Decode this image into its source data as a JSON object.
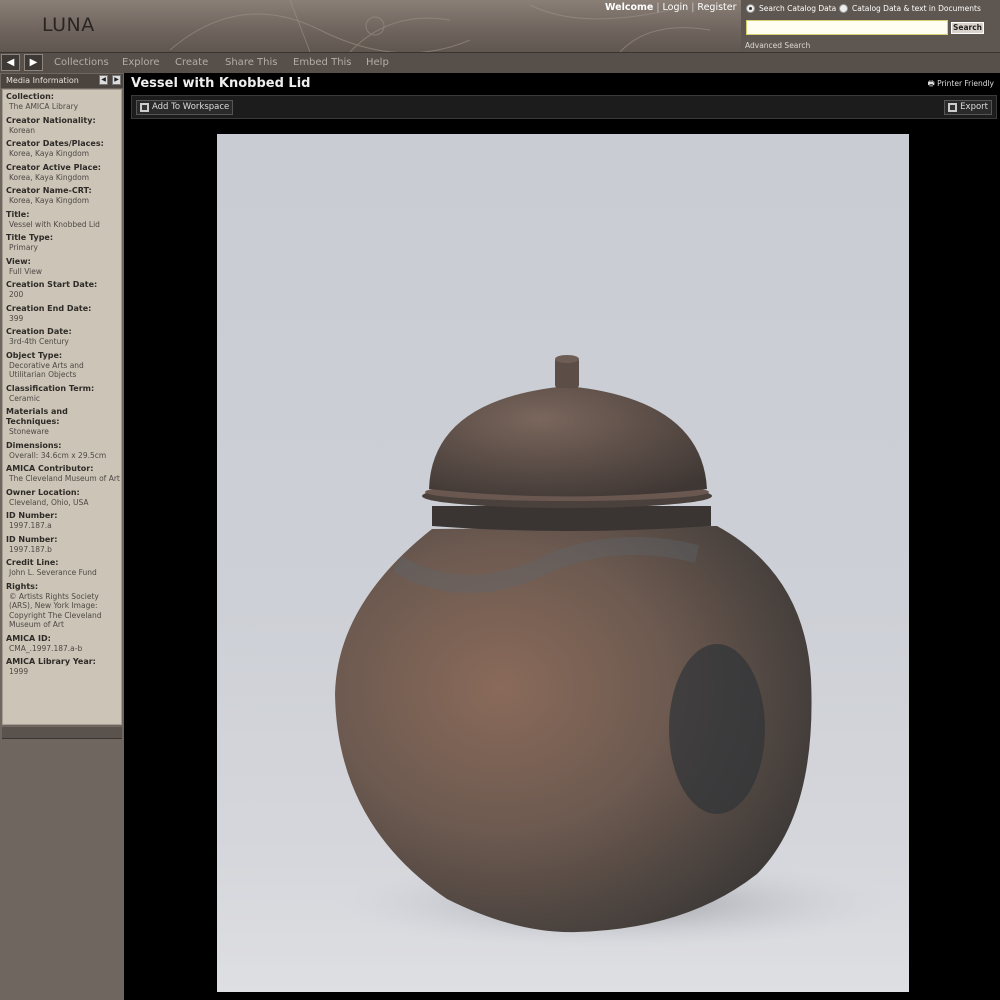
{
  "header": {
    "logo": "LUNA",
    "welcome": "Welcome",
    "login": "Login",
    "register": "Register",
    "search_option_catalog": "Search Catalog Data",
    "search_option_documents": "Catalog Data & text in Documents",
    "search_button": "Search",
    "advanced_search": "Advanced Search"
  },
  "nav": {
    "back_arrow": "◀",
    "forward_arrow": "▶",
    "items": [
      "Collections",
      "Explore",
      "Create",
      "Share This",
      "Embed This",
      "Help"
    ]
  },
  "panel": {
    "title": "Media Information",
    "collapse": "◀",
    "expand": "▶"
  },
  "metadata": [
    {
      "label": "Collection:",
      "value": "The AMICA Library"
    },
    {
      "label": "Creator Nationality:",
      "value": "Korean"
    },
    {
      "label": "Creator Dates/Places:",
      "value": "Korea, Kaya Kingdom"
    },
    {
      "label": "Creator Active Place:",
      "value": "Korea, Kaya Kingdom"
    },
    {
      "label": "Creator Name-CRT:",
      "value": "Korea, Kaya Kingdom"
    },
    {
      "label": "Title:",
      "value": "Vessel with Knobbed Lid"
    },
    {
      "label": "Title Type:",
      "value": "Primary"
    },
    {
      "label": "View:",
      "value": "Full View"
    },
    {
      "label": "Creation Start Date:",
      "value": "200"
    },
    {
      "label": "Creation End Date:",
      "value": "399"
    },
    {
      "label": "Creation Date:",
      "value": "3rd-4th Century"
    },
    {
      "label": "Object Type:",
      "value": "Decorative Arts and Utilitarian Objects"
    },
    {
      "label": "Classification Term:",
      "value": "Ceramic"
    },
    {
      "label": "Materials and Techniques:",
      "value": "Stoneware"
    },
    {
      "label": "Dimensions:",
      "value": "Overall: 34.6cm x 29.5cm"
    },
    {
      "label": "AMICA Contributor:",
      "value": "The Cleveland Museum of Art"
    },
    {
      "label": "Owner Location:",
      "value": "Cleveland, Ohio, USA"
    },
    {
      "label": "ID Number:",
      "value": "1997.187.a"
    },
    {
      "label": "ID Number:",
      "value": "1997.187.b"
    },
    {
      "label": "Credit Line:",
      "value": "John L. Severance Fund"
    },
    {
      "label": "Rights:",
      "value": "© Artists Rights Society (ARS), New York Image: Copyright The Cleveland Museum of Art"
    },
    {
      "label": "AMICA ID:",
      "value": "CMA_.1997.187.a-b"
    },
    {
      "label": "AMICA Library Year:",
      "value": "1999"
    }
  ],
  "main": {
    "title": "Vessel with Knobbed Lid",
    "printer_friendly": "Printer Friendly",
    "add_to_workspace": "Add To Workspace",
    "export": "Export"
  },
  "colors": {
    "header_bg": "#7a7069",
    "nav_bg": "#57504a",
    "panel_bg": "#cbc4b7",
    "accent_search_border": "#d8cf70"
  }
}
